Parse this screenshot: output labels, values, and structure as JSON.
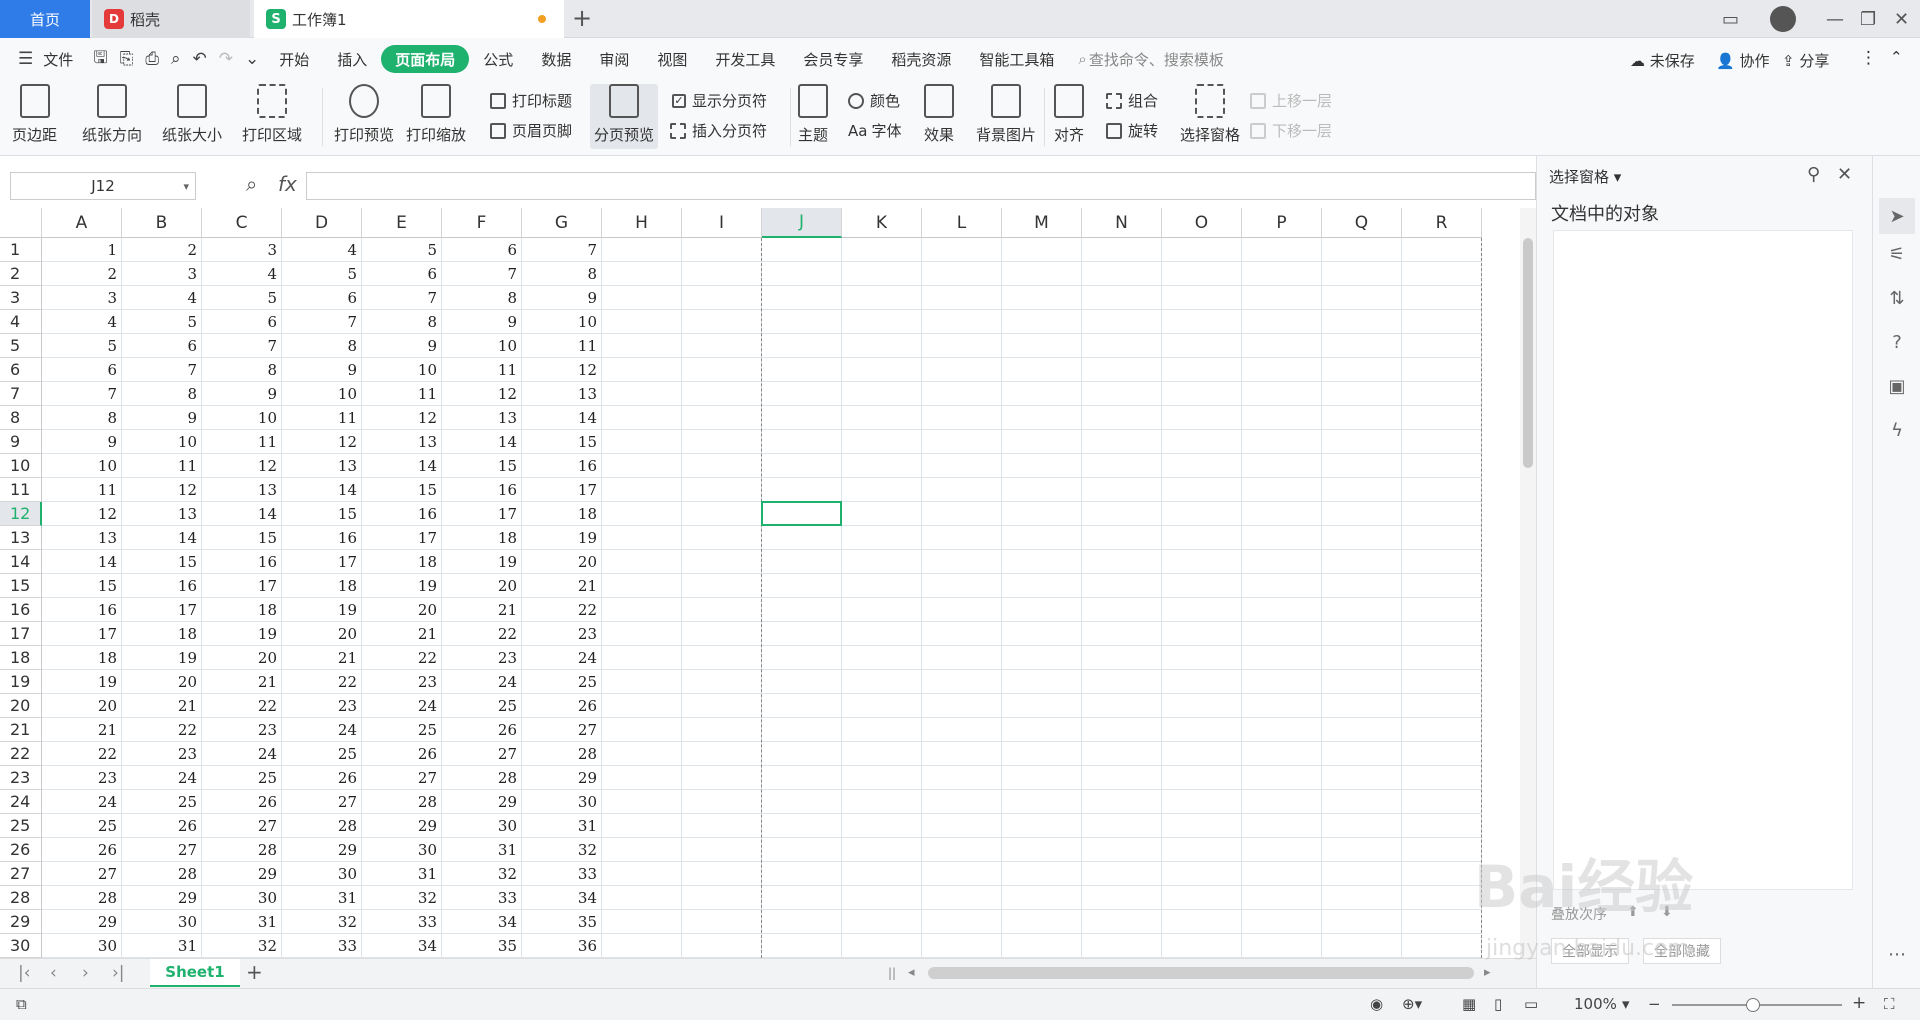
{
  "tabs": {
    "home": "首页",
    "docer": "稻壳",
    "workbook": "工作簿1"
  },
  "menu": {
    "file": "文件",
    "items": [
      "开始",
      "插入",
      "页面布局",
      "公式",
      "数据",
      "审阅",
      "视图",
      "开发工具",
      "会员专享",
      "稻壳资源",
      "智能工具箱"
    ],
    "active_index": 2,
    "search": "查找命令、搜索模板",
    "unsaved": "未保存",
    "collab": "协作",
    "share": "分享"
  },
  "ribbon": {
    "margin": "页边距",
    "orient": "纸张方向",
    "size": "纸张大小",
    "area": "打印区域",
    "preview": "打印预览",
    "scale": "打印缩放",
    "print_title": "打印标题",
    "header_footer": "页眉页脚",
    "page_break_preview": "分页预览",
    "show_breaks": "显示分页符",
    "insert_break": "插入分页符",
    "theme": "主题",
    "color": "颜色",
    "font": "字体",
    "effect": "效果",
    "bg_image": "背景图片",
    "align": "对齐",
    "group": "组合",
    "rotate": "旋转",
    "select_pane": "选择窗格",
    "move_up": "上移一层",
    "move_down": "下移一层"
  },
  "formula": {
    "namebox": "J12",
    "fx": "fx",
    "value": ""
  },
  "grid": {
    "columns": [
      "A",
      "B",
      "C",
      "D",
      "E",
      "F",
      "G",
      "H",
      "I",
      "J",
      "K",
      "L",
      "M",
      "N",
      "O",
      "P",
      "Q",
      "R"
    ],
    "rows": 30,
    "active_row": 12,
    "active_col": "J",
    "start_values": [
      1,
      2,
      3,
      4,
      5,
      6,
      7
    ]
  },
  "sheets": {
    "tabs": [
      "Sheet1"
    ]
  },
  "status": {
    "zoom": "100%"
  },
  "pane": {
    "title": "选择窗格",
    "subtitle": "文档中的对象",
    "order_label": "叠放次序",
    "show_all": "全部显示",
    "hide_all": "全部隐藏"
  },
  "watermark": {
    "text": "Bai经验",
    "url": "jingyan.baidu.com"
  }
}
